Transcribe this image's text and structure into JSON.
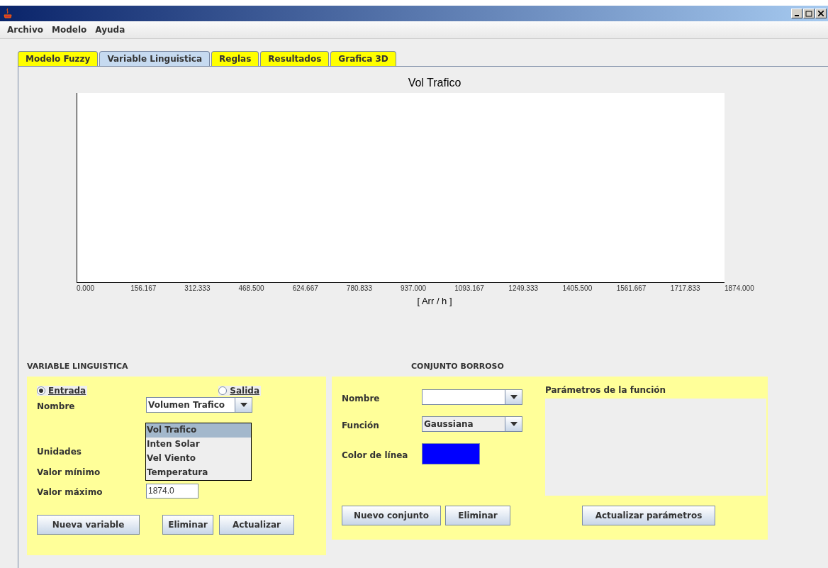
{
  "menu": [
    "Archivo",
    "Modelo",
    "Ayuda"
  ],
  "tabs": [
    {
      "label": "Modelo Fuzzy",
      "selected": false
    },
    {
      "label": "Variable Linguistica",
      "selected": true
    },
    {
      "label": "Reglas",
      "selected": false
    },
    {
      "label": "Resultados",
      "selected": false
    },
    {
      "label": "Grafica 3D",
      "selected": false
    }
  ],
  "chart": {
    "title": "Vol Trafico",
    "x_axis_label": "[ Arr / h ]",
    "x_tick_labels": [
      "0.000",
      "156.167",
      "312.333",
      "468.500",
      "624.667",
      "780.833",
      "937.000",
      "1093.167",
      "1249.333",
      "1405.500",
      "1561.667",
      "1717.833",
      "1874.000"
    ]
  },
  "variable": {
    "heading": "VARIABLE LINGUISTICA",
    "radios": [
      {
        "label": "Entrada",
        "selected": true
      },
      {
        "label": "Salida",
        "selected": false
      }
    ],
    "name_label": "Nombre",
    "name_value": "Volumen Trafico",
    "dropdown_options": [
      {
        "label": "Vol Trafico",
        "selected": true
      },
      {
        "label": "Inten Solar",
        "selected": false
      },
      {
        "label": "Vel Viento",
        "selected": false
      },
      {
        "label": "Temperatura",
        "selected": false
      }
    ],
    "units_label": "Unidades",
    "min_label": "Valor mínimo",
    "max_label": "Valor máximo",
    "max_value": "1874.0",
    "buttons": [
      "Nueva variable",
      "Eliminar",
      "Actualizar"
    ]
  },
  "fuzzy_set": {
    "heading": "CONJUNTO BORROSO",
    "name_label": "Nombre",
    "function_label": "Función",
    "function_value": "Gaussiana",
    "color_label": "Color de línea",
    "params_label": "Parámetros de la función",
    "buttons": [
      "Nuevo conjunto",
      "Eliminar"
    ],
    "update_button": "Actualizar parámetros"
  }
}
